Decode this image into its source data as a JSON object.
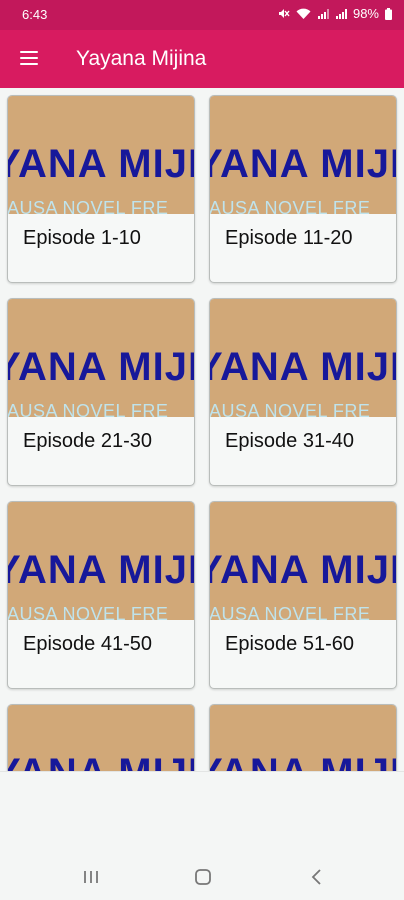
{
  "status_bar": {
    "time": "6:43",
    "battery": "98%",
    "icons": [
      "mute-icon",
      "wifi-icon",
      "signal-icon",
      "signal-icon",
      "battery-icon"
    ]
  },
  "app_bar": {
    "title": "Yayana Mijina",
    "menu_icon": "hamburger-menu-icon",
    "background": "#d81b60"
  },
  "cover": {
    "title": "YANA MIJI",
    "subtitle": "AUSA NOVEL FRE",
    "background": "#d1a878",
    "title_color": "#17189a",
    "subtitle_color": "#bfe3ec"
  },
  "episodes": [
    {
      "label": "Episode 1-10"
    },
    {
      "label": "Episode 11-20"
    },
    {
      "label": "Episode 21-30"
    },
    {
      "label": "Episode 31-40"
    },
    {
      "label": "Episode 41-50"
    },
    {
      "label": "Episode 51-60"
    },
    {
      "label": ""
    },
    {
      "label": ""
    }
  ],
  "nav_bar": {
    "buttons": [
      "recent-apps-icon",
      "home-icon",
      "back-icon"
    ]
  }
}
